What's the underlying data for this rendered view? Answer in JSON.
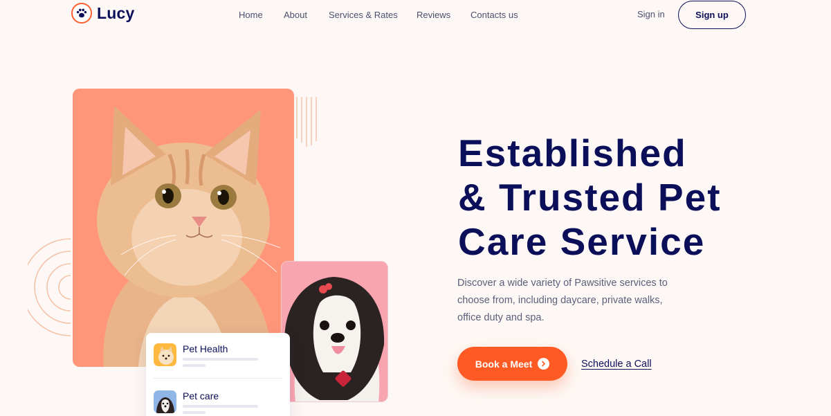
{
  "header": {
    "logo_text": "Lucy",
    "logo_icon": "paw-icon",
    "nav": [
      {
        "label": "Home"
      },
      {
        "label": "About"
      },
      {
        "label": "Services & Rates"
      },
      {
        "label": "Reviews"
      },
      {
        "label": "Contacts us"
      }
    ],
    "signin_label": "Sign in",
    "signup_label": "Sign up"
  },
  "hero": {
    "title_lines": [
      "Established",
      "& Trusted Pet",
      "Care Service"
    ],
    "description": "Discover a wide variety of Pawsitive services to choose from, including daycare, private walks, office duty and spa.",
    "primary_cta": "Book a Meet",
    "secondary_cta": "Schedule a Call"
  },
  "services": [
    {
      "title": "Pet Health",
      "thumb": "pomeranian-thumbnail"
    },
    {
      "title": "Pet care",
      "thumb": "dog-thumbnail"
    }
  ],
  "images": {
    "main": "kitten-photo",
    "secondary": "shih-tzu-photo"
  },
  "colors": {
    "brand_navy": "#0b0f59",
    "accent_orange": "#ff5a23",
    "cat_bg": "#ff967a",
    "dog_bg": "#f8a5b0",
    "page_bg": "#fdf8f5"
  }
}
